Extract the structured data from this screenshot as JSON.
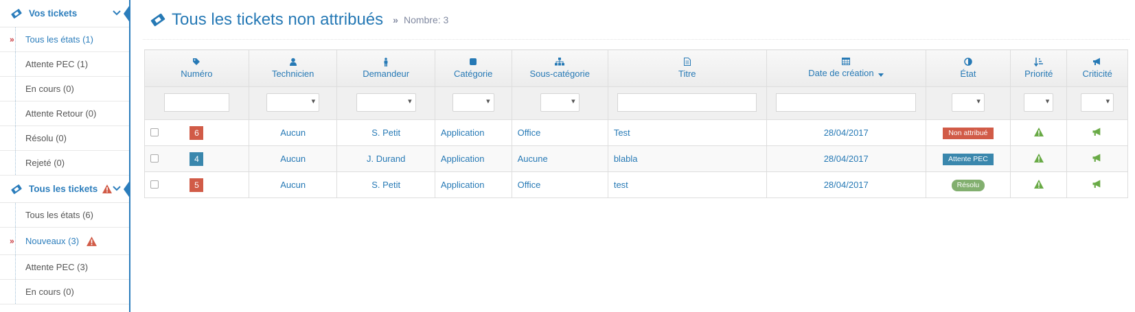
{
  "sidebar": {
    "vos_tickets": {
      "label": "Vos tickets",
      "items": [
        {
          "label": "Tous les états (1)"
        },
        {
          "label": "Attente PEC (1)"
        },
        {
          "label": "En cours (0)"
        },
        {
          "label": "Attente Retour (0)"
        },
        {
          "label": "Résolu (0)"
        },
        {
          "label": "Rejeté (0)"
        }
      ]
    },
    "tous_tickets": {
      "label": "Tous les tickets",
      "items": [
        {
          "label": "Tous les états (6)"
        },
        {
          "label": "Nouveaux (3)"
        },
        {
          "label": "Attente PEC (3)"
        },
        {
          "label": "En cours (0)"
        }
      ]
    },
    "active_arrow": "»"
  },
  "header": {
    "title": "Tous les tickets non attribués",
    "separator": "»",
    "count": "Nombre: 3"
  },
  "table": {
    "columns": {
      "numero": "Numéro",
      "technicien": "Technicien",
      "demandeur": "Demandeur",
      "categorie": "Catégorie",
      "souscategorie": "Sous-catégorie",
      "titre": "Titre",
      "date": "Date de création",
      "etat": "État",
      "priorite": "Priorité",
      "criticite": "Criticité"
    },
    "rows": [
      {
        "numero": "6",
        "numero_color": "#d15b47",
        "technicien": "Aucun",
        "demandeur": "S. Petit",
        "categorie": "Application",
        "souscategorie": "Office",
        "titre": "Test",
        "date": "28/04/2017",
        "etat": "Non attribué",
        "etat_color": "red"
      },
      {
        "numero": "4",
        "numero_color": "#3a87ad",
        "technicien": "Aucun",
        "demandeur": "J. Durand",
        "categorie": "Application",
        "souscategorie": "Aucune",
        "titre": "blabla",
        "date": "28/04/2017",
        "etat": "Attente PEC",
        "etat_color": "blue"
      },
      {
        "numero": "5",
        "numero_color": "#d15b47",
        "technicien": "Aucun",
        "demandeur": "S. Petit",
        "categorie": "Application",
        "souscategorie": "Office",
        "titre": "test",
        "date": "28/04/2017",
        "etat": "Résolu",
        "etat_color": "green"
      }
    ]
  },
  "colors": {
    "primary": "#2679b5",
    "danger": "#d15b47",
    "info": "#3a87ad",
    "success": "#82af6f",
    "icon_green": "#69aa46"
  }
}
